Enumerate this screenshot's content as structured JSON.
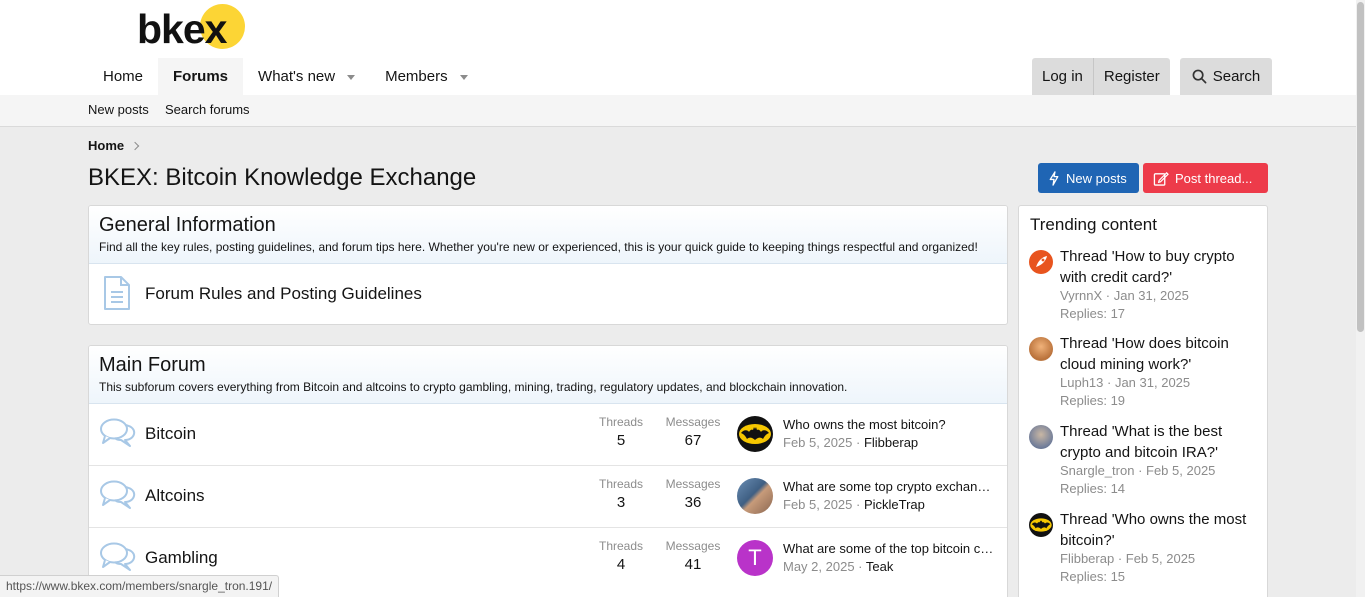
{
  "header": {
    "logo_text": "bkex",
    "nav": [
      {
        "label": "Home",
        "active": false,
        "has_dropdown": false
      },
      {
        "label": "Forums",
        "active": true,
        "has_dropdown": false
      },
      {
        "label": "What's new",
        "active": false,
        "has_dropdown": true
      },
      {
        "label": "Members",
        "active": false,
        "has_dropdown": true
      }
    ],
    "login_label": "Log in",
    "register_label": "Register",
    "search_label": "Search"
  },
  "subnav": {
    "new_posts": "New posts",
    "search_forums": "Search forums"
  },
  "breadcrumb": {
    "home": "Home"
  },
  "page_title": "BKEX: Bitcoin Knowledge Exchange",
  "actions": {
    "new_posts": "New posts",
    "post_thread": "Post thread..."
  },
  "general": {
    "title": "General Information",
    "description": "Find all the key rules, posting guidelines, and forum tips here. Whether you're new or experienced, this is your quick guide to keeping things respectful and organized!",
    "nodes": [
      {
        "title": "Forum Rules and Posting Guidelines",
        "icon": "document-icon"
      }
    ]
  },
  "main_forum": {
    "title": "Main Forum",
    "description": "This subforum covers everything from Bitcoin and altcoins to crypto gambling, mining, trading, regulatory updates, and blockchain innovation.",
    "threads_label": "Threads",
    "messages_label": "Messages",
    "nodes": [
      {
        "title": "Bitcoin",
        "threads": "5",
        "messages": "67",
        "latest_title": "Who owns the most bitcoin?",
        "latest_date": "Feb 5, 2025",
        "latest_user": "Flibberap",
        "avatar": "batman-avatar"
      },
      {
        "title": "Altcoins",
        "threads": "3",
        "messages": "36",
        "latest_title": "What are some top crypto exchanges?",
        "latest_date": "Feb 5, 2025",
        "latest_user": "PickleTrap",
        "avatar": "photo-avatar"
      },
      {
        "title": "Gambling",
        "threads": "4",
        "messages": "41",
        "latest_title": "What are some of the top bitcoin casinos?",
        "latest_date": "May 2, 2025",
        "latest_user": "Teak",
        "avatar": "letter-avatar",
        "avatar_letter": "T",
        "avatar_color": "#b933c9"
      }
    ]
  },
  "trending": {
    "title": "Trending content",
    "items": [
      {
        "title": "Thread 'How to buy crypto with credit card?'",
        "user": "VyrnnX",
        "date": "Jan 31, 2025",
        "replies": "Replies: 17",
        "avatar_color": "#e8541e"
      },
      {
        "title": "Thread 'How does bitcoin cloud mining work?'",
        "user": "Luph13",
        "date": "Jan 31, 2025",
        "replies": "Replies: 19",
        "avatar_color": "#d88a4a"
      },
      {
        "title": "Thread 'What is the best crypto and bitcoin IRA?'",
        "user": "Snargle_tron",
        "date": "Feb 5, 2025",
        "replies": "Replies: 14",
        "avatar_color": "#8a97b0"
      },
      {
        "title": "Thread 'Who owns the most bitcoin?'",
        "user": "Flibberap",
        "date": "Feb 5, 2025",
        "replies": "Replies: 15",
        "avatar_color": "#111111"
      }
    ]
  },
  "status_url": "https://www.bkex.com/members/snargle_tron.191/",
  "colors": {
    "primary": "#1f65b4",
    "danger": "#ed3b4a",
    "logo_yellow": "#fcd535"
  }
}
